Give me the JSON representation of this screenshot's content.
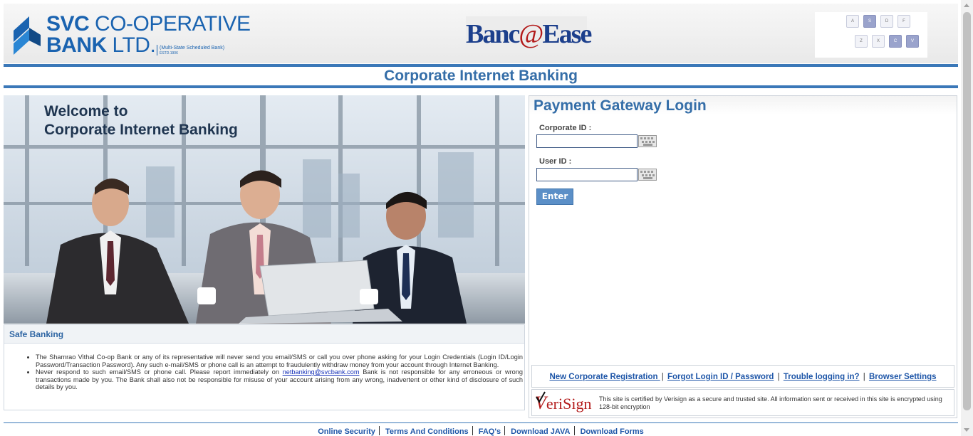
{
  "header": {
    "logo_line1_bold": "SVC",
    "logo_line1_rest": " CO-OPERATIVE",
    "logo_line2_bold": "BANK",
    "logo_line2_rest": " LTD.",
    "logo_sub_1": "(Multi-State Scheduled Bank)",
    "logo_sub_2": "ESTD.1906",
    "product_name_1": "Banc",
    "product_name_at": "@",
    "product_name_2": "Ease",
    "keyboard_keys": [
      "A",
      "S",
      "D",
      "F",
      "Z",
      "X",
      "C",
      "V"
    ]
  },
  "banner": {
    "title": "Corporate Internet Banking"
  },
  "welcome": {
    "line1": "Welcome to",
    "line2": "Corporate Internet Banking"
  },
  "safe_banking": {
    "title": "Safe Banking",
    "item1": "The Shamrao Vithal Co-op Bank or any of its representative will never send you email/SMS or call you over phone asking for your Login Credentials (Login ID/Login Password/Transaction Password). Any such e-mail/SMS or phone call is an attempt to fraudulently withdraw money from your account through Internet Banking.",
    "item2_before": "Never respond to such email/SMS or phone call. Please report immediately on ",
    "item2_link": "netbanking@svcbank.com",
    "item2_after": " Bank is not responsible for any erroneous or wrong transactions made by you. The Bank shall also not be responsible for misuse of your account arising from any wrong, inadvertent or other kind of disclosure of such details by you."
  },
  "login": {
    "title": "Payment Gateway Login",
    "corporate_id_label": "Corporate ID :",
    "corporate_id_value": "",
    "user_id_label": "User ID :",
    "user_id_value": "",
    "enter_label": "Enter"
  },
  "links": {
    "new_registration": "New Corporate Registration ",
    "forgot_login": "Forgot Login ID / Password",
    "trouble": "Trouble logging in?",
    "browser_settings": "Browser Settings",
    "separator": "|"
  },
  "verisign": {
    "logo_v": "V",
    "logo_rest": "eriSign",
    "text": "This site is certified by Verisign as a secure and trusted site. All information sent or received in this site is encrypted using 128-bit encryption"
  },
  "footer": {
    "items": [
      "Online Security",
      "Terms And Conditions",
      "FAQ's",
      "Download JAVA",
      "Download Forms"
    ]
  },
  "colors": {
    "brand_blue": "#1a63b0",
    "heading_blue": "#356ea8",
    "rule_blue": "#3b78b8",
    "link_blue": "#1e56a8",
    "verisign_red": "#b31b1b"
  }
}
